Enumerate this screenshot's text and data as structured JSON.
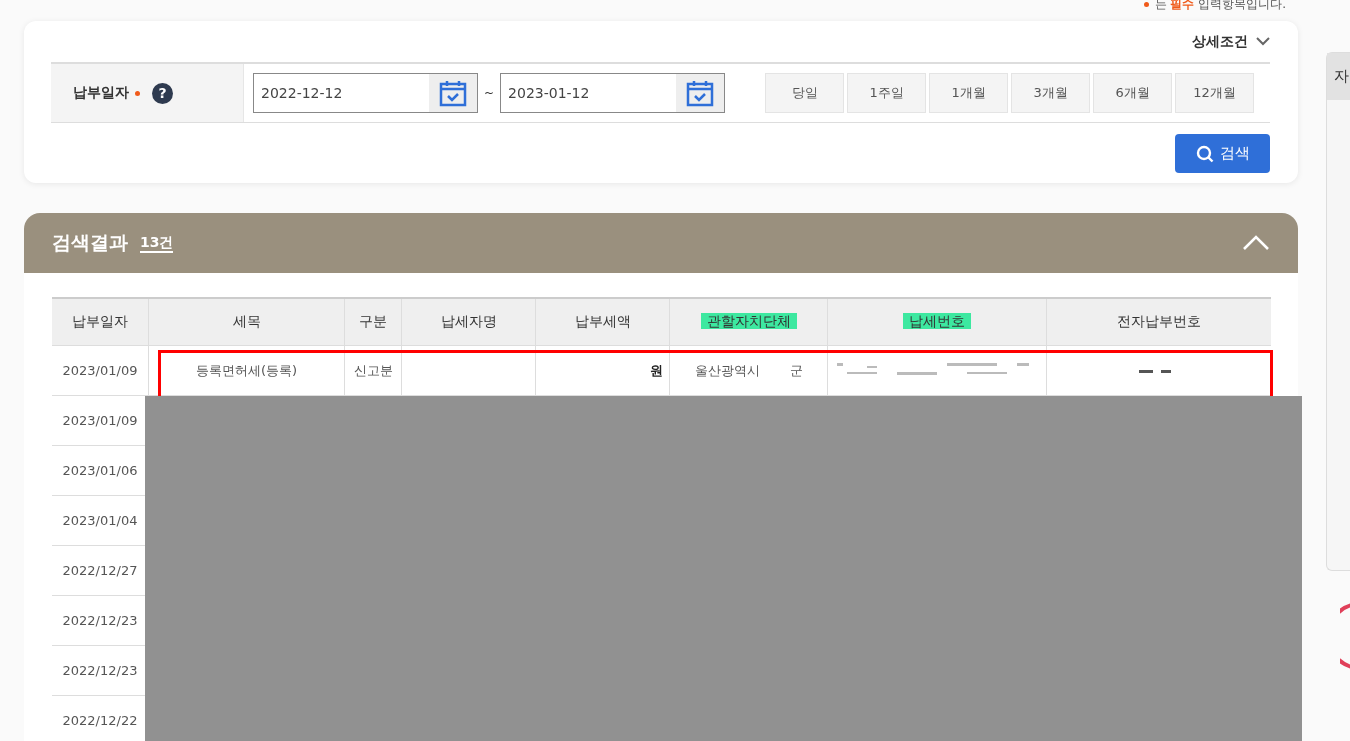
{
  "required_note": {
    "prefix": "는",
    "emphasis": "필수",
    "suffix": "입력항목입니다."
  },
  "search": {
    "detail_toggle": "상세조건",
    "expanded": false,
    "date_label": "납부일자",
    "required": true,
    "help": "?",
    "from": "2022-12-12",
    "separator": "~",
    "to": "2023-01-12",
    "periods": [
      {
        "label": "당일",
        "selected": false
      },
      {
        "label": "1주일",
        "selected": false
      },
      {
        "label": "1개월",
        "selected": false
      },
      {
        "label": "3개월",
        "selected": false
      },
      {
        "label": "6개월",
        "selected": false
      },
      {
        "label": "12개월",
        "selected": false
      }
    ],
    "button": "검색"
  },
  "results": {
    "title": "검색결과",
    "count": "13건",
    "expanded": true,
    "columns": [
      {
        "label": "납부일자",
        "highlighted": false
      },
      {
        "label": "세목",
        "highlighted": false
      },
      {
        "label": "구분",
        "highlighted": false
      },
      {
        "label": "납세자명",
        "highlighted": false
      },
      {
        "label": "납부세액",
        "highlighted": false
      },
      {
        "label": "관할자치단체",
        "highlighted": true
      },
      {
        "label": "납세번호",
        "highlighted": true
      },
      {
        "label": "전자납부번호",
        "highlighted": false
      }
    ],
    "rows": [
      {
        "date": "2023/01/09",
        "tax_item": "등록면허세(등록)",
        "type": "신고분",
        "amount": "원",
        "district": "울산광역시",
        "district_suffix": "군",
        "masked": true,
        "outlined": true
      },
      {
        "date": "2023/01/09"
      },
      {
        "date": "2023/01/06"
      },
      {
        "date": "2023/01/04"
      },
      {
        "date": "2022/12/27"
      },
      {
        "date": "2022/12/23"
      },
      {
        "date": "2022/12/23"
      },
      {
        "date": "2022/12/22"
      }
    ]
  },
  "side_panel": {
    "title": "자"
  }
}
